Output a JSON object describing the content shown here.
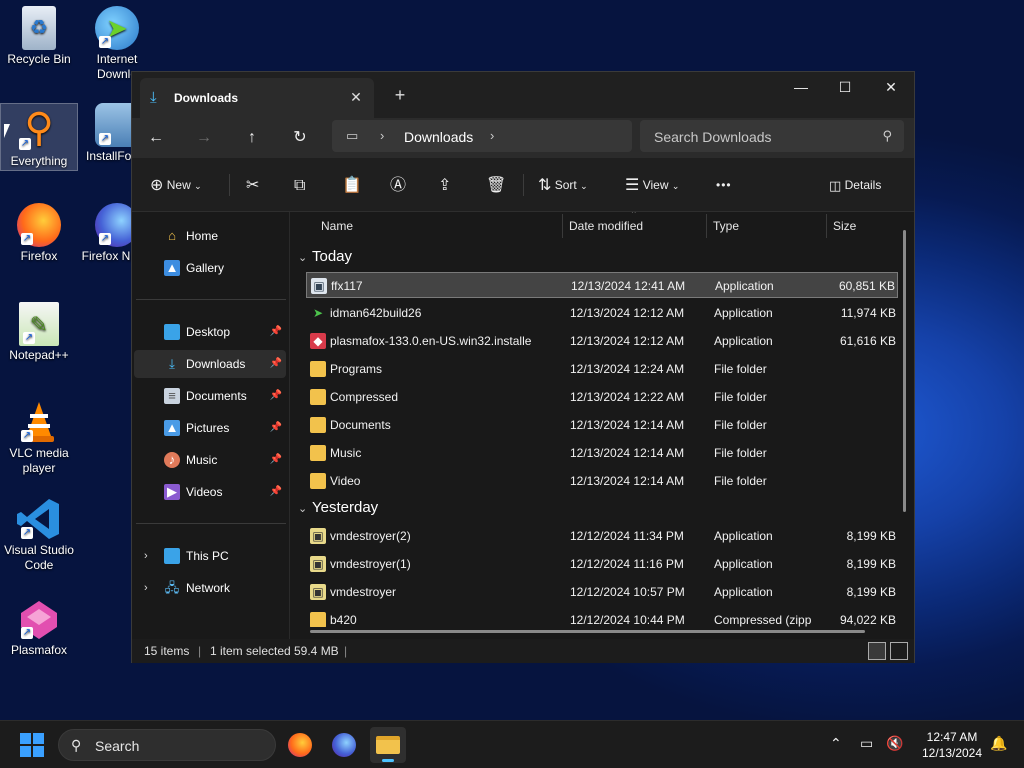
{
  "desktop": {
    "icons": [
      {
        "label": "Recycle Bin"
      },
      {
        "label": "Internet Downlo"
      },
      {
        "label": "Everything"
      },
      {
        "label": "InstallFo"
      },
      {
        "label": "Firefox"
      },
      {
        "label": "Firefox Nightl"
      },
      {
        "label": "Notepad++"
      },
      {
        "label": "VLC media player"
      },
      {
        "label": "Visual Studio Code"
      },
      {
        "label": "Plasmafox"
      }
    ]
  },
  "window": {
    "tab_title": "Downloads",
    "new_tab": "+",
    "controls": {
      "minimize": "—",
      "maximize": "☐",
      "close": "✕"
    },
    "address": {
      "crumb": "Downloads"
    },
    "search": {
      "placeholder": "Search Downloads"
    },
    "toolbar": {
      "new_label": "New",
      "sort_label": "Sort",
      "view_label": "View",
      "more_label": "•••",
      "details_label": "Details"
    },
    "sidebar": {
      "items": [
        {
          "label": "Home"
        },
        {
          "label": "Gallery"
        },
        {
          "label": "Desktop"
        },
        {
          "label": "Downloads"
        },
        {
          "label": "Documents"
        },
        {
          "label": "Pictures"
        },
        {
          "label": "Music"
        },
        {
          "label": "Videos"
        },
        {
          "label": "This PC"
        },
        {
          "label": "Network"
        }
      ]
    },
    "columns": [
      "Name",
      "Date modified",
      "Type",
      "Size"
    ],
    "groups": {
      "today": "Today",
      "yesterday": "Yesterday"
    },
    "today_files": [
      {
        "name": "ffx117",
        "date": "12/13/2024 12:41 AM",
        "type": "Application",
        "size": "60,851 KB"
      },
      {
        "name": "idman642build26",
        "date": "12/13/2024 12:12 AM",
        "type": "Application",
        "size": "11,974 KB"
      },
      {
        "name": "plasmafox-133.0.en-US.win32.installe",
        "date": "12/13/2024 12:12 AM",
        "type": "Application",
        "size": "61,616 KB"
      },
      {
        "name": "Programs",
        "date": "12/13/2024 12:24 AM",
        "type": "File folder",
        "size": ""
      },
      {
        "name": "Compressed",
        "date": "12/13/2024 12:22 AM",
        "type": "File folder",
        "size": ""
      },
      {
        "name": "Documents",
        "date": "12/13/2024 12:14 AM",
        "type": "File folder",
        "size": ""
      },
      {
        "name": "Music",
        "date": "12/13/2024 12:14 AM",
        "type": "File folder",
        "size": ""
      },
      {
        "name": "Video",
        "date": "12/13/2024 12:14 AM",
        "type": "File folder",
        "size": ""
      }
    ],
    "yesterday_files": [
      {
        "name": "vmdestroyer(2)",
        "date": "12/12/2024 11:34 PM",
        "type": "Application",
        "size": "8,199 KB"
      },
      {
        "name": "vmdestroyer(1)",
        "date": "12/12/2024 11:16 PM",
        "type": "Application",
        "size": "8,199 KB"
      },
      {
        "name": "vmdestroyer",
        "date": "12/12/2024 10:57 PM",
        "type": "Application",
        "size": "8,199 KB"
      },
      {
        "name": "b420",
        "date": "12/12/2024 10:44 PM",
        "type": "Compressed (zipp",
        "size": "94,022 KB"
      }
    ],
    "status": {
      "items": "15 items",
      "selected": "1 item selected",
      "size": "59.4 MB"
    }
  },
  "taskbar": {
    "search_placeholder": "Search",
    "time": "12:47 AM",
    "date": "12/13/2024"
  }
}
